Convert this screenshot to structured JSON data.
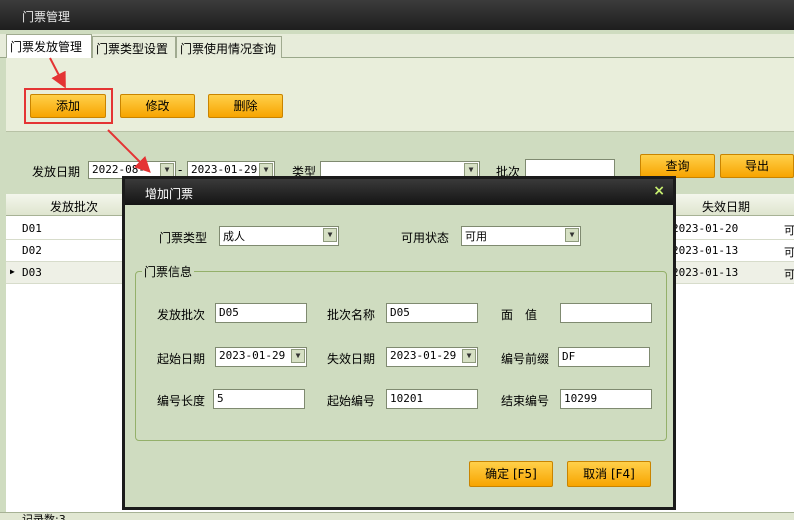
{
  "window": {
    "title": "门票管理"
  },
  "tabs": [
    "门票发放管理",
    "门票类型设置",
    "门票使用情况查询"
  ],
  "toolbar": {
    "add": "添加",
    "edit": "修改",
    "delete": "删除"
  },
  "filter": {
    "issue_date_label": "发放日期",
    "date_from": "2022-08-",
    "range_sep": "-",
    "date_to": "2023-01-29",
    "type_label": "类型",
    "type_value": "",
    "batch_label": "批次",
    "batch_value": "",
    "query": "查询",
    "export": "导出"
  },
  "grid": {
    "col_batch": "发放批次",
    "col_expire": "失效日期",
    "rows": [
      {
        "batch": "D01",
        "expire": "2023-01-20",
        "tail": "可"
      },
      {
        "batch": "D02",
        "expire": "2023-01-13",
        "tail": "可"
      },
      {
        "batch": "D03",
        "expire": "2023-01-13",
        "tail": "可"
      }
    ]
  },
  "status": {
    "text": "记录数:3"
  },
  "dialog": {
    "title": "增加门票",
    "close": "×",
    "ticket_type_label": "门票类型",
    "ticket_type_value": "成人",
    "avail_label": "可用状态",
    "avail_value": "可用",
    "group_title": "门票信息",
    "fields": {
      "issue_batch_label": "发放批次",
      "issue_batch_value": "D05",
      "batch_name_label": "批次名称",
      "batch_name_value": "D05",
      "face_value_label": "面　值",
      "face_value_value": "",
      "start_date_label": "起始日期",
      "start_date_value": "2023-01-29",
      "expire_date_label": "失效日期",
      "expire_date_value": "2023-01-29",
      "prefix_label": "编号前缀",
      "prefix_value": "DF",
      "length_label": "编号长度",
      "length_value": "5",
      "start_no_label": "起始编号",
      "start_no_value": "10201",
      "end_no_label": "结束编号",
      "end_no_value": "10299"
    },
    "ok": "确定 [F5]",
    "cancel": "取消 [F4]"
  },
  "colors": {
    "accent": "#f7a400",
    "highlight": "#e43434",
    "background": "#cfdcc0"
  },
  "icons": {
    "dropdown": "chevron-down-icon",
    "close": "close-icon",
    "row_marker": "row-pointer-icon"
  }
}
